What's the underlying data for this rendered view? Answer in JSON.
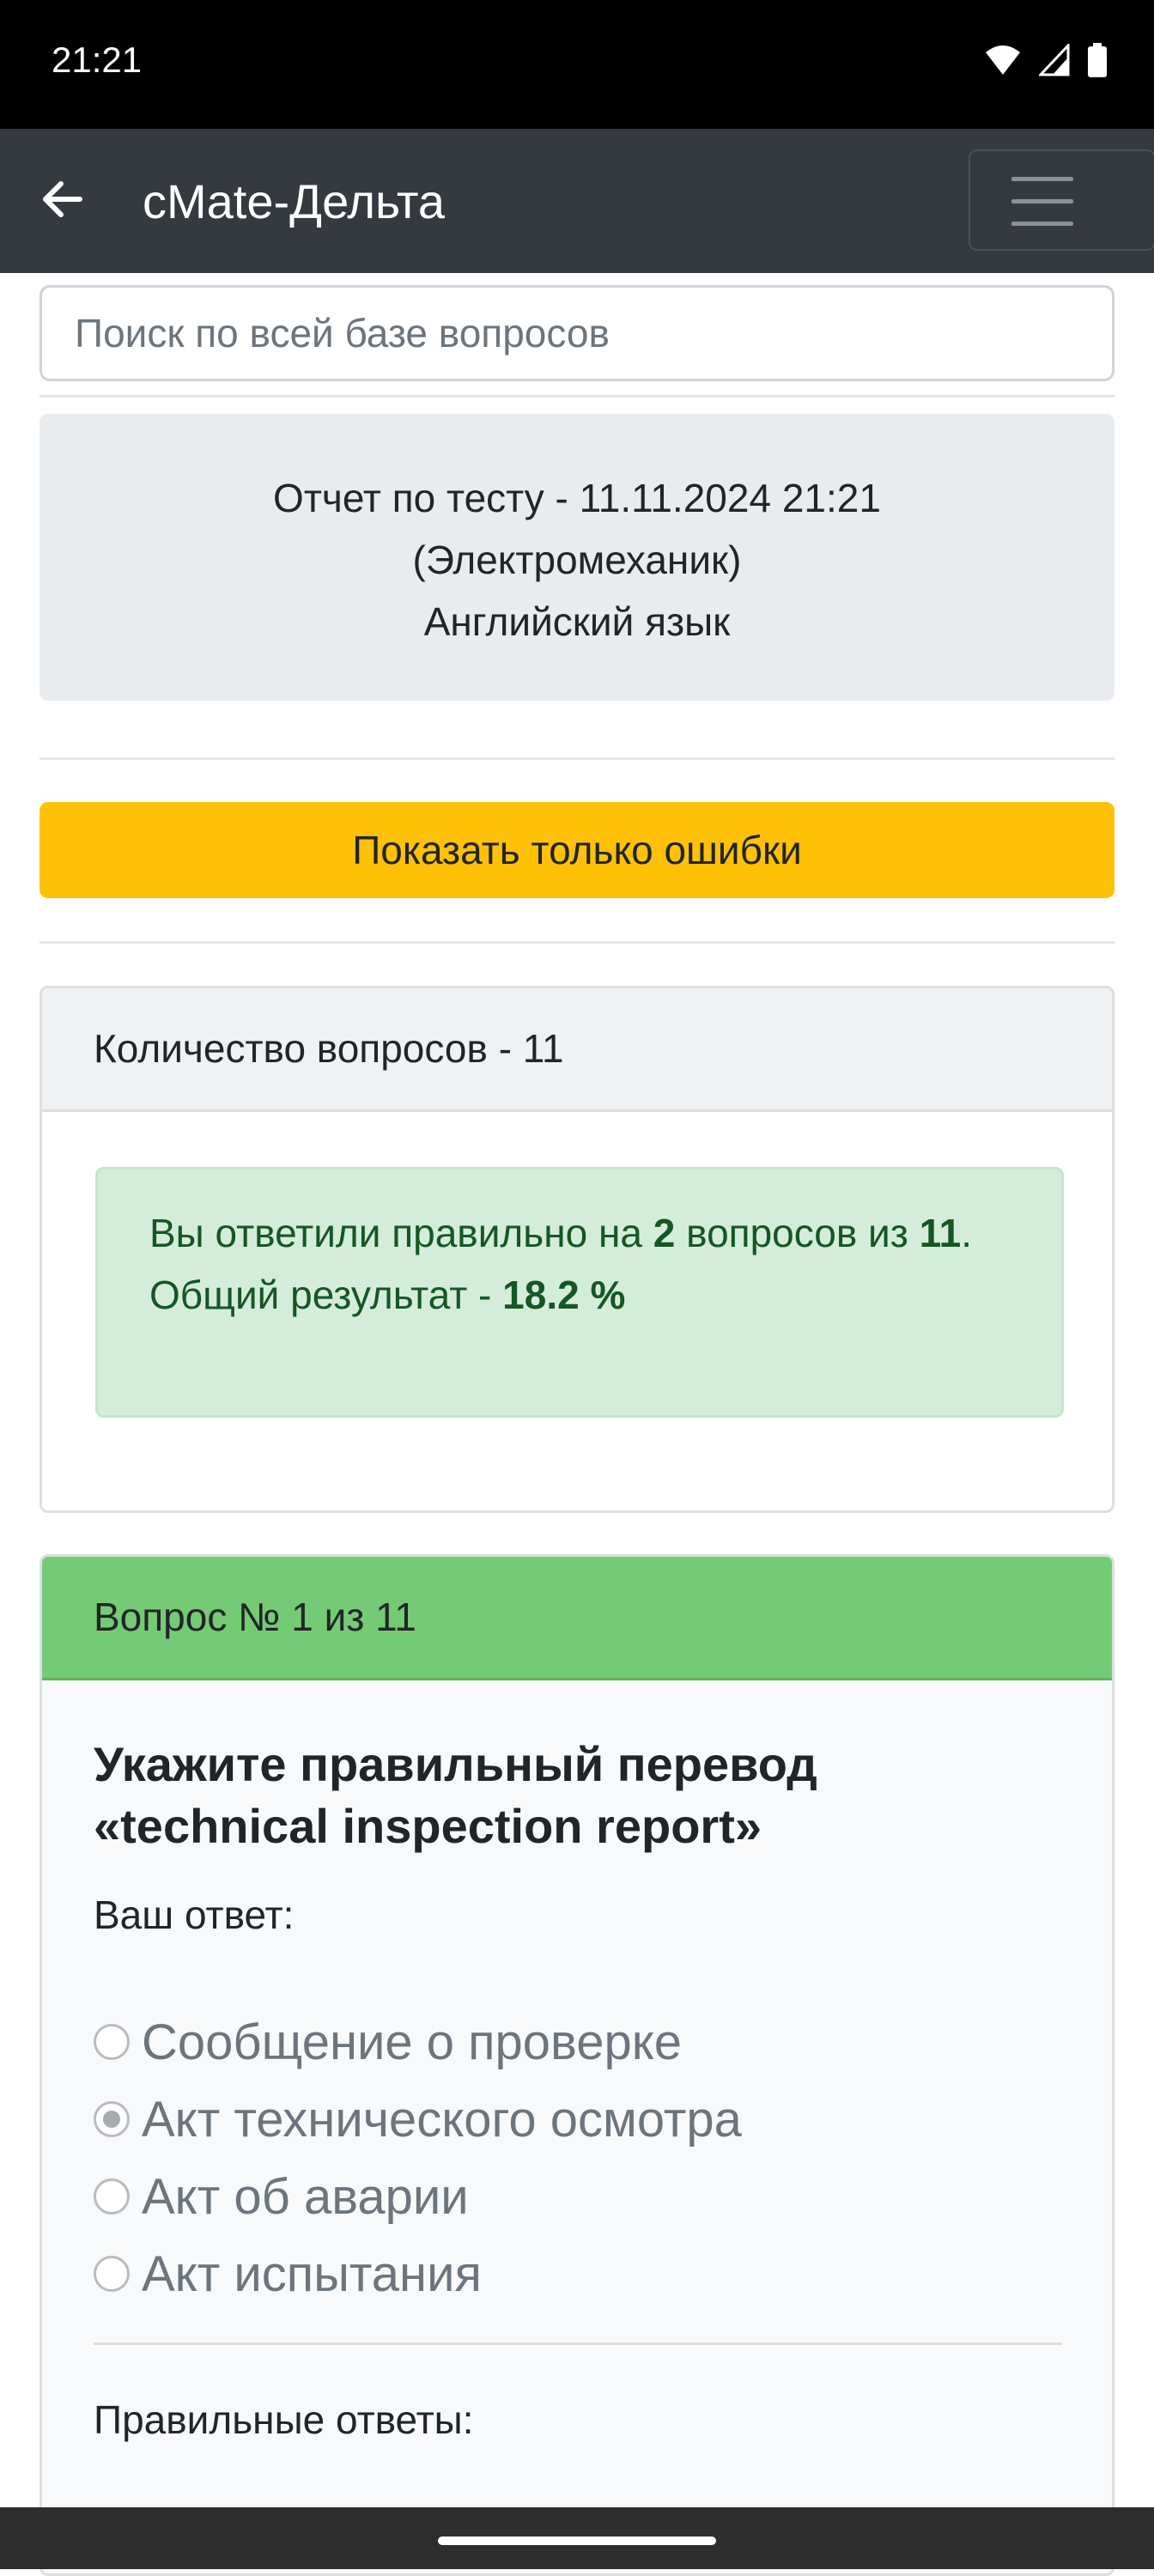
{
  "status_bar": {
    "time": "21:21"
  },
  "app_bar": {
    "title": "cMate-Дельта"
  },
  "search": {
    "placeholder": "Поиск по всей базе вопросов"
  },
  "report": {
    "line1": "Отчет по тесту - 11.11.2024 21:21",
    "line2": "(Электромеханик)",
    "line3": "Английский язык"
  },
  "errors_button": {
    "label": "Показать только ошибки"
  },
  "summary": {
    "header": "Количество вопросов - 11",
    "answered_prefix": "Вы ответили правильно на ",
    "correct_count": "2",
    "answered_middle": " вопросов из ",
    "total": "11",
    "period": ".",
    "result_prefix": "Общий результат - ",
    "result_percent": "18.2 %"
  },
  "question": {
    "header": "Вопрос № 1 из 11",
    "text_line1": "Укажите правильный перевод",
    "text_line2": "«technical inspection report»",
    "your_answer_label": "Ваш ответ:",
    "options": [
      {
        "label": "Сообщение о проверке",
        "checked": false
      },
      {
        "label": "Акт технического осмотра",
        "checked": true
      },
      {
        "label": "Акт об аварии",
        "checked": false
      },
      {
        "label": "Акт испытания",
        "checked": false
      }
    ],
    "correct_answers_label": "Правильные ответы:"
  }
}
